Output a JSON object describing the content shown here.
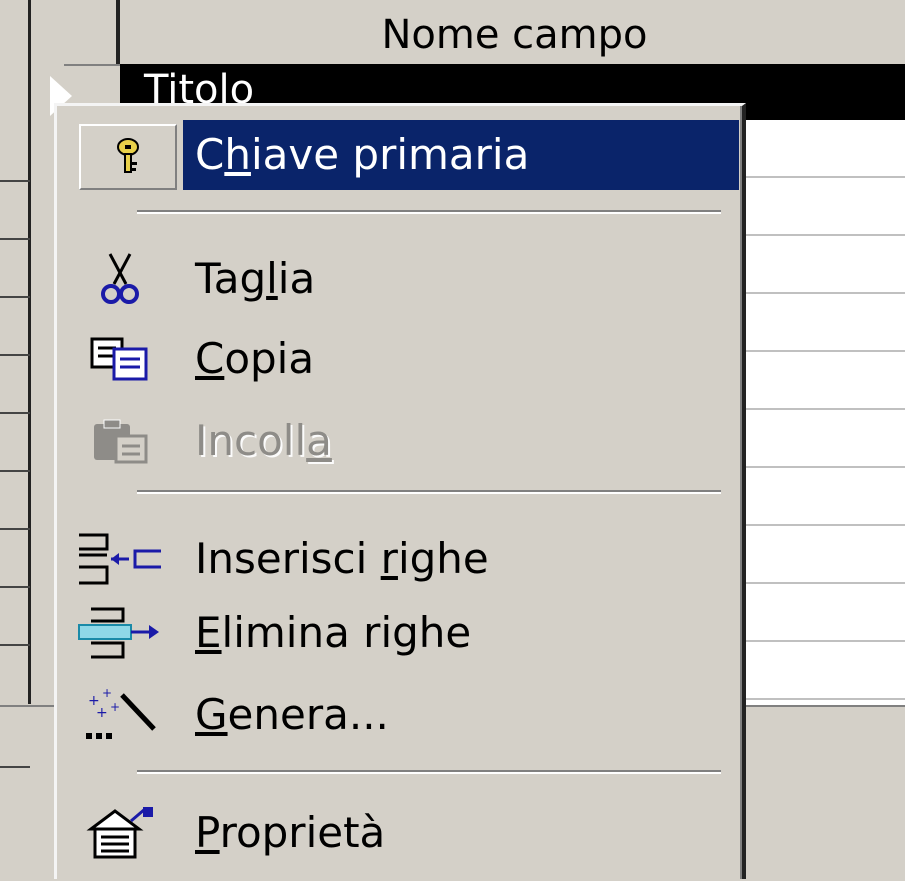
{
  "table": {
    "header_label": "Nome campo",
    "current_row_text": "Titolo"
  },
  "context_menu": {
    "items": [
      {
        "id": "primary-key",
        "label_before": "C",
        "accel": "h",
        "label_after": "iave primaria",
        "icon": "key-icon",
        "state": "selected"
      },
      {
        "id": "cut",
        "label_before": "Tag",
        "accel": "l",
        "label_after": "ia",
        "icon": "scissors-icon",
        "state": "normal"
      },
      {
        "id": "copy",
        "label_before": "",
        "accel": "C",
        "label_after": "opia",
        "icon": "copy-icon",
        "state": "normal"
      },
      {
        "id": "paste",
        "label_before": "Incoll",
        "accel": "a",
        "label_after": "",
        "icon": "paste-icon",
        "state": "disabled"
      },
      {
        "id": "insert-rows",
        "label_before": "Inserisci ",
        "accel": "r",
        "label_after": "ighe",
        "icon": "insert-rows-icon",
        "state": "normal"
      },
      {
        "id": "delete-rows",
        "label_before": "",
        "accel": "E",
        "label_after": "limina righe",
        "icon": "delete-rows-icon",
        "state": "normal"
      },
      {
        "id": "build",
        "label_before": "",
        "accel": "G",
        "label_after": "enera...",
        "icon": "magic-wand-icon",
        "state": "normal"
      },
      {
        "id": "properties",
        "label_before": "",
        "accel": "P",
        "label_after": "roprietà",
        "icon": "properties-icon",
        "state": "normal"
      }
    ]
  },
  "colors": {
    "menu_background": "#d4d0c8",
    "highlight": "#0a246a",
    "disabled_text": "#8e8c88"
  }
}
